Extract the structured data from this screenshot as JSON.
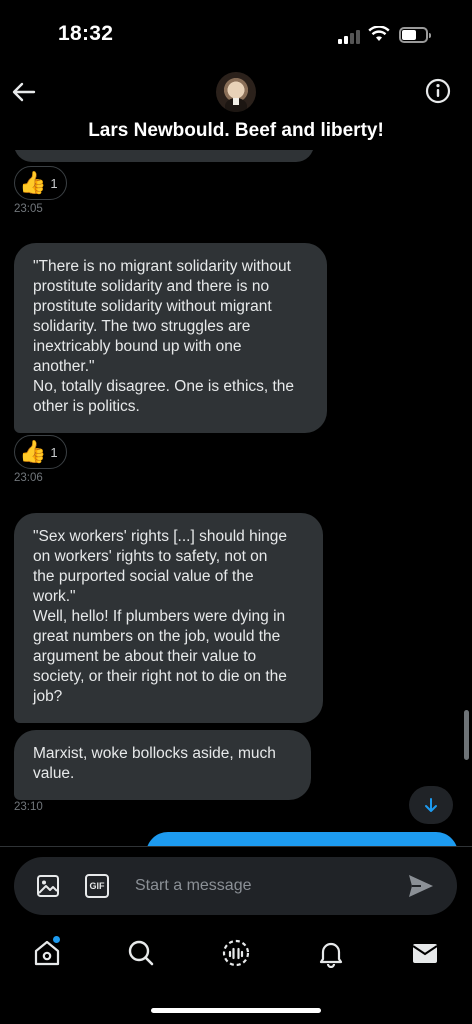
{
  "status_bar": {
    "time": "18:32",
    "battery_level": 0.62
  },
  "header": {
    "title": "Lars Newbould. Beef and liberty!"
  },
  "messages": [
    {
      "text": "\"There is no migrant solidarity without\nprostitute solidarity and there is no\nprostitute solidarity without migrant\nsolidarity. The two struggles are\ninextricably bound up with one\nanother.\"\nNo, totally disagree. One is ethics, the\nother is politics."
    },
    {
      "text": "\"Sex workers' rights [...] should hinge\non workers' rights to safety, not on\nthe purported social value of the\nwork.\"\nWell, hello! If plumbers were dying in\ngreat numbers on the job, would the\nargument be  about their value to\nsociety, or their right not to die on the\njob?"
    },
    {
      "text": "Marxist, woke bollocks aside, much\nvalue."
    }
  ],
  "reactions": [
    {
      "emoji": "👍",
      "count": "1"
    },
    {
      "emoji": "👍",
      "count": "1"
    }
  ],
  "timestamps": [
    "23:05",
    "23:06",
    "23:10"
  ],
  "composer": {
    "placeholder": "Start a message",
    "gif_label": "GIF"
  }
}
